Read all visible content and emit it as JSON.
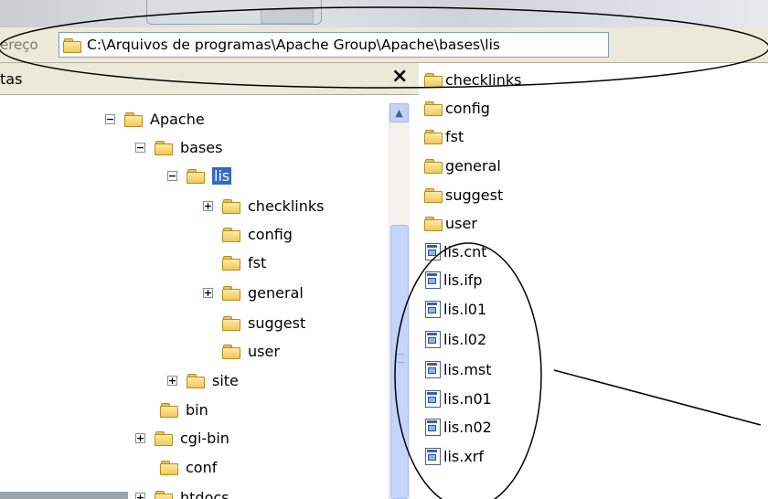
{
  "address_bar": {
    "label": "ereço",
    "path": "C:\\Arquivos de programas\\Apache Group\\Apache\\bases\\lis"
  },
  "folders_pane": {
    "title": "tas",
    "close_glyph": "×",
    "tree": [
      {
        "label": "Apache",
        "expander": "⊟"
      },
      {
        "label": "bases",
        "expander": "⊟"
      },
      {
        "label": "lis",
        "expander": "⊟",
        "selected": true
      },
      {
        "label": "checklinks",
        "expander": "⊞"
      },
      {
        "label": "config"
      },
      {
        "label": "fst"
      },
      {
        "label": "general",
        "expander": "⊞"
      },
      {
        "label": "suggest"
      },
      {
        "label": "user"
      },
      {
        "label": "site",
        "expander": "⊞"
      },
      {
        "label": "bin"
      },
      {
        "label": "cgi-bin",
        "expander": "⊞"
      },
      {
        "label": "conf"
      },
      {
        "label": "htdocs",
        "expander": "⊞"
      }
    ]
  },
  "file_list": {
    "folders": [
      "checklinks",
      "config",
      "fst",
      "general",
      "suggest",
      "user"
    ],
    "files": [
      "lis.cnt",
      "lis.ifp",
      "lis.l01",
      "lis.l02",
      "lis.mst",
      "lis.n01",
      "lis.n02",
      "lis.xrf"
    ]
  },
  "icons": {
    "folder": "folder-icon",
    "file": "document-icon",
    "scroll_up": "arrow-up-icon",
    "close": "close-icon"
  },
  "colors": {
    "selection": "#316ac5",
    "toolbar": "#ece9d8",
    "scrollbar_thumb": "#c4d4fc",
    "folder_yellow": "#f0c95a"
  }
}
